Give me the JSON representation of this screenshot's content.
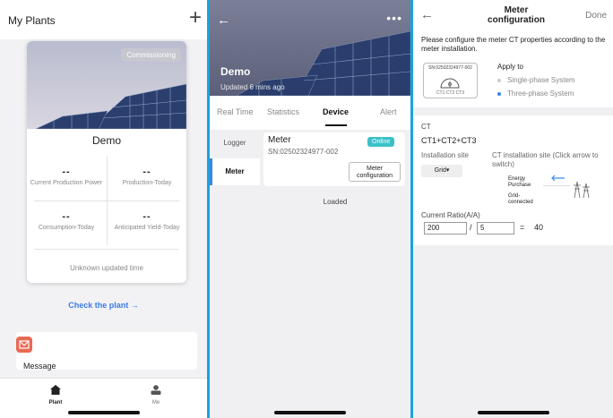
{
  "colors": {
    "accent": "#3b7be8",
    "online": "#3cc0c8",
    "message_icon": "#e86a54",
    "frame": "#19a3e0"
  },
  "panel1": {
    "title": "My Plants",
    "add_icon": "plus-icon",
    "card": {
      "status_badge": "Commissioning",
      "name": "Demo",
      "stats": [
        {
          "value": "--",
          "label": "Current Production Power"
        },
        {
          "value": "--",
          "label": "Production-Today"
        },
        {
          "value": "--",
          "label": "Consumption-Today"
        },
        {
          "value": "--",
          "label": "Anticipated Yield-Today"
        }
      ],
      "updated": "Unknown updated time"
    },
    "check_link": "Check the plant →",
    "message": {
      "label": "Message",
      "icon": "envelope-icon"
    },
    "tabbar": [
      {
        "label": "Plant",
        "icon": "home-icon"
      },
      {
        "label": "Me",
        "icon": "person-icon"
      }
    ]
  },
  "panel2": {
    "back_icon": "←",
    "more_icon": "•••",
    "plant_name": "Demo",
    "updated": "Updated 6 mins ago",
    "tabs": [
      "Real Time",
      "Statistics",
      "Device",
      "Alert"
    ],
    "active_tab": "Device",
    "sidebar": [
      "Logger",
      "Meter"
    ],
    "active_side": "Meter",
    "meter": {
      "title": "Meter",
      "sn": "SN:02502324977-002",
      "status": "Online",
      "config_btn": "Meter configuration"
    },
    "loaded": "Loaded"
  },
  "panel3": {
    "back_icon": "←",
    "title": "Meter configuration",
    "done": "Done",
    "instruction": "Please configure the meter CT properties according to the meter installation.",
    "meter_sn": "SN:02502324977-002",
    "meter_ct": "CT1 CT2 CT3",
    "apply_to": "Apply to",
    "options": [
      {
        "label": "Single-phase System",
        "selected": false
      },
      {
        "label": "Three-phase System",
        "selected": true
      }
    ],
    "ct_label": "CT",
    "ct_name": "CT1+CT2+CT3",
    "install_site_label": "Installation site",
    "ct_site_label": "CT installation site (Click arrow to switch)",
    "grid_btn": "Grid▾",
    "energy_purchase": "Energy Purchase",
    "grid_connected": "Grid-connected",
    "ratio_label": "Current Ratio(A/A)",
    "ratio_primary": "200",
    "ratio_slash": "/",
    "ratio_secondary": "5",
    "equals": "=",
    "ratio_result": "40"
  }
}
